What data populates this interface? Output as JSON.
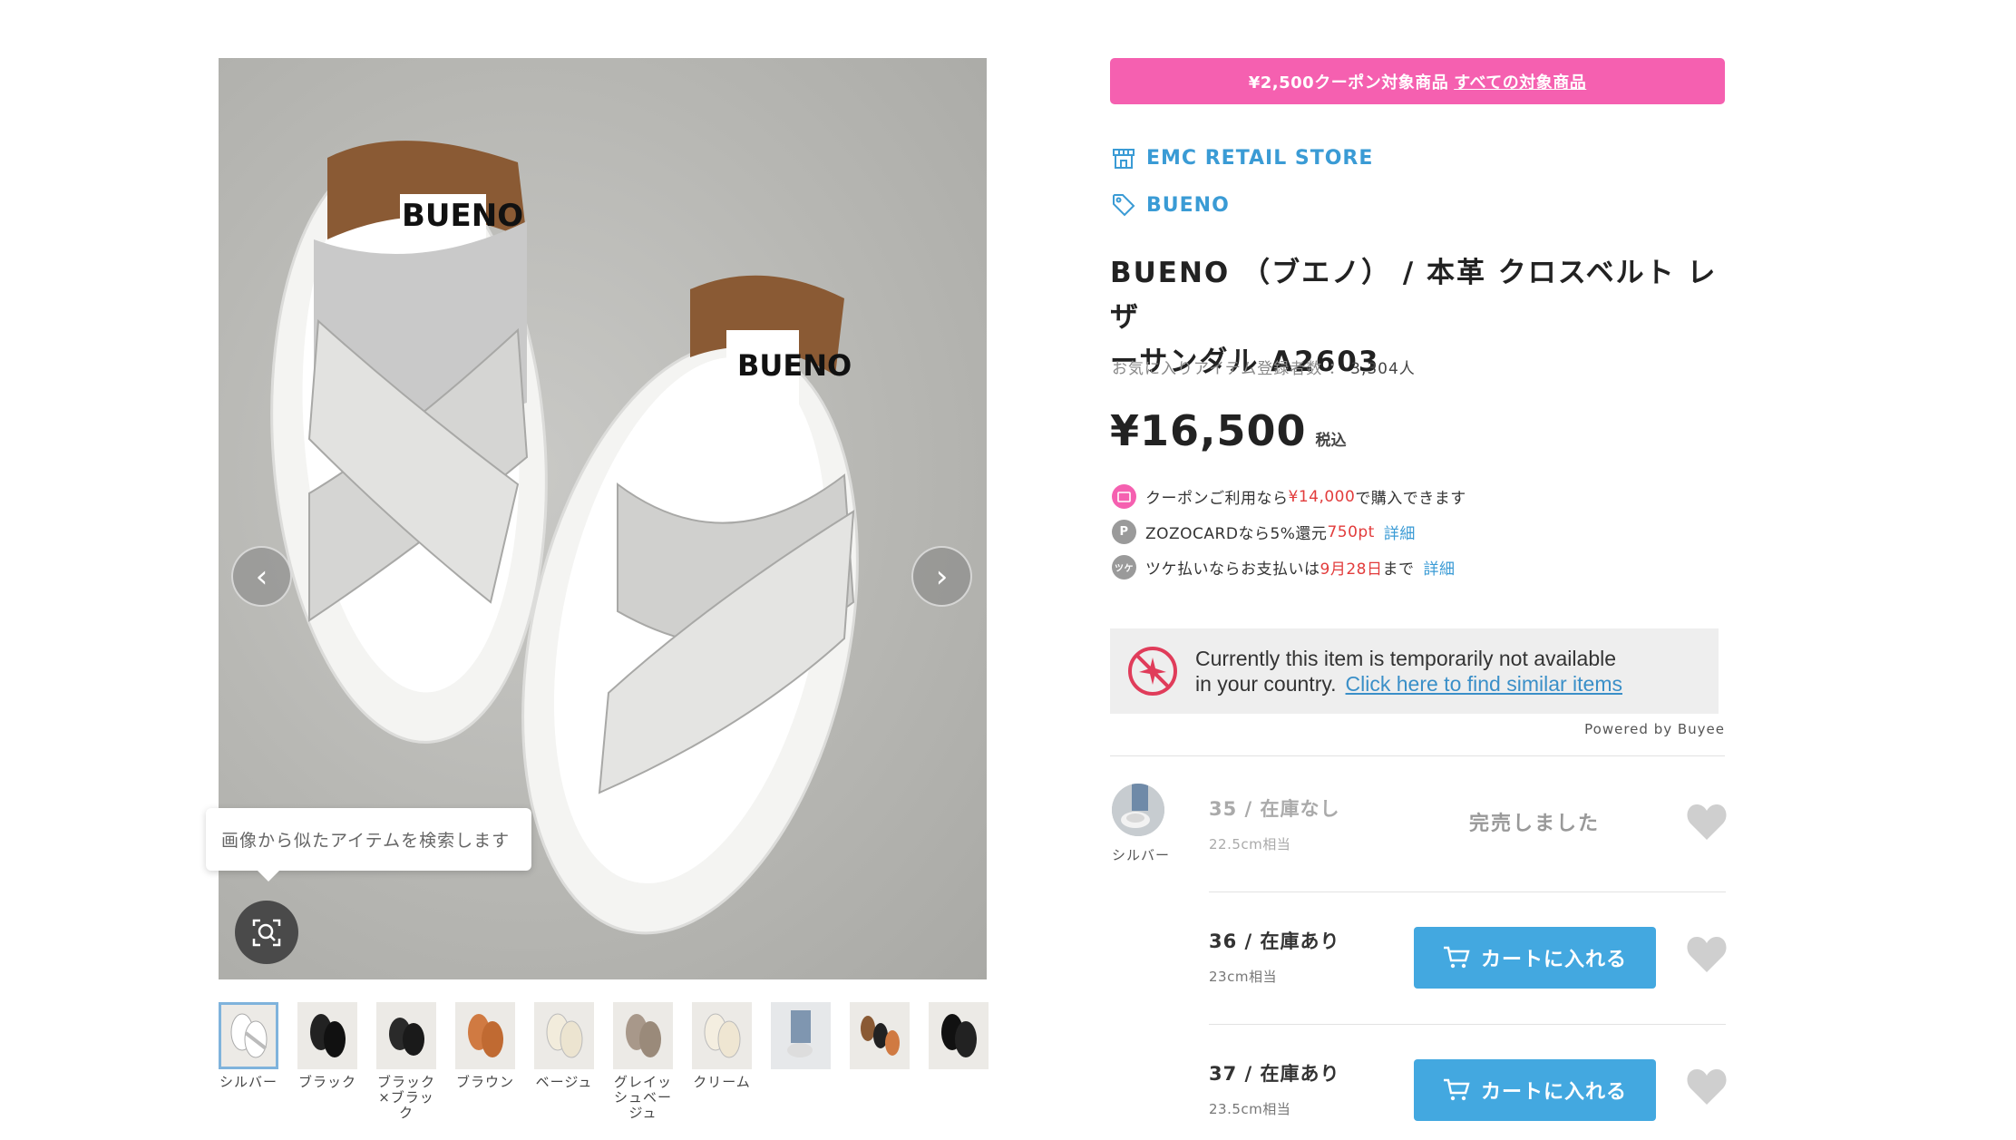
{
  "product": {
    "coupon_banner": "¥2,500クーポン対象商品",
    "coupon_link": "すべての対象商品",
    "store_name": "EMC RETAIL STORE",
    "brand_name": "BUENO",
    "title_line1": "BUENO （ブエノ） / 本革 クロスベルト レザ",
    "title_line2": "ーサンダル A2603",
    "favorite_label": "お気に入りアイテム登録者数 ：",
    "favorite_count": "3,304人",
    "price": "¥16,500",
    "tax_label": "税込",
    "main_image_brand_mark": "BUENO"
  },
  "benefits": {
    "coupon_pre": "クーポンご利用なら",
    "coupon_price": "¥14,000",
    "coupon_post": "で購入できます",
    "zozocard_icon": "P",
    "zozocard_pre": "ZOZOCARDなら5%還元",
    "zozocard_points": "750pt",
    "zozocard_detail": "詳細",
    "tsuke_icon": "ツケ",
    "tsuke_pre": "ツケ払いならお支払いは",
    "tsuke_date": "9月28日",
    "tsuke_post": "まで",
    "tsuke_detail": "詳細"
  },
  "notice": {
    "line1": "Currently this item is temporarily not available",
    "line2": "in your country.",
    "link": "Click here to find similar items",
    "powered_by": "Powered by Buyee"
  },
  "image_search": {
    "tooltip": "画像から似たアイテムを検索します"
  },
  "thumbnails": [
    {
      "label": "シルバー",
      "color": "#d8d8d6"
    },
    {
      "label": "ブラック",
      "color": "#1e1e1e"
    },
    {
      "label": "ブラック×ブラック",
      "color": "#2a2a2a"
    },
    {
      "label": "ブラウン",
      "color": "#c8733f"
    },
    {
      "label": "ベージュ",
      "color": "#e8e2d2"
    },
    {
      "label": "グレイッシュベージュ",
      "color": "#a39484"
    },
    {
      "label": "クリーム",
      "color": "#efe8d8"
    },
    {
      "label": "",
      "color": "#8aa0b8"
    },
    {
      "label": "",
      "color": "#7b5a3e"
    },
    {
      "label": "",
      "color": "#111111"
    }
  ],
  "variant": {
    "color_name": "シルバー",
    "sizes": [
      {
        "size": "35",
        "stock": "在庫なし",
        "sub": "22.5cm相当",
        "status": "完売しました"
      },
      {
        "size": "36",
        "stock": "在庫あり",
        "sub": "23cm相当",
        "button": "カートに入れる"
      },
      {
        "size": "37",
        "stock": "在庫あり",
        "sub": "23.5cm相当",
        "button": "カートに入れる"
      }
    ]
  },
  "colors": {
    "accent_blue": "#43a8e0",
    "link_blue": "#3a9bd5",
    "coupon_pink": "#f560b0",
    "price_red": "#e23c3c"
  }
}
